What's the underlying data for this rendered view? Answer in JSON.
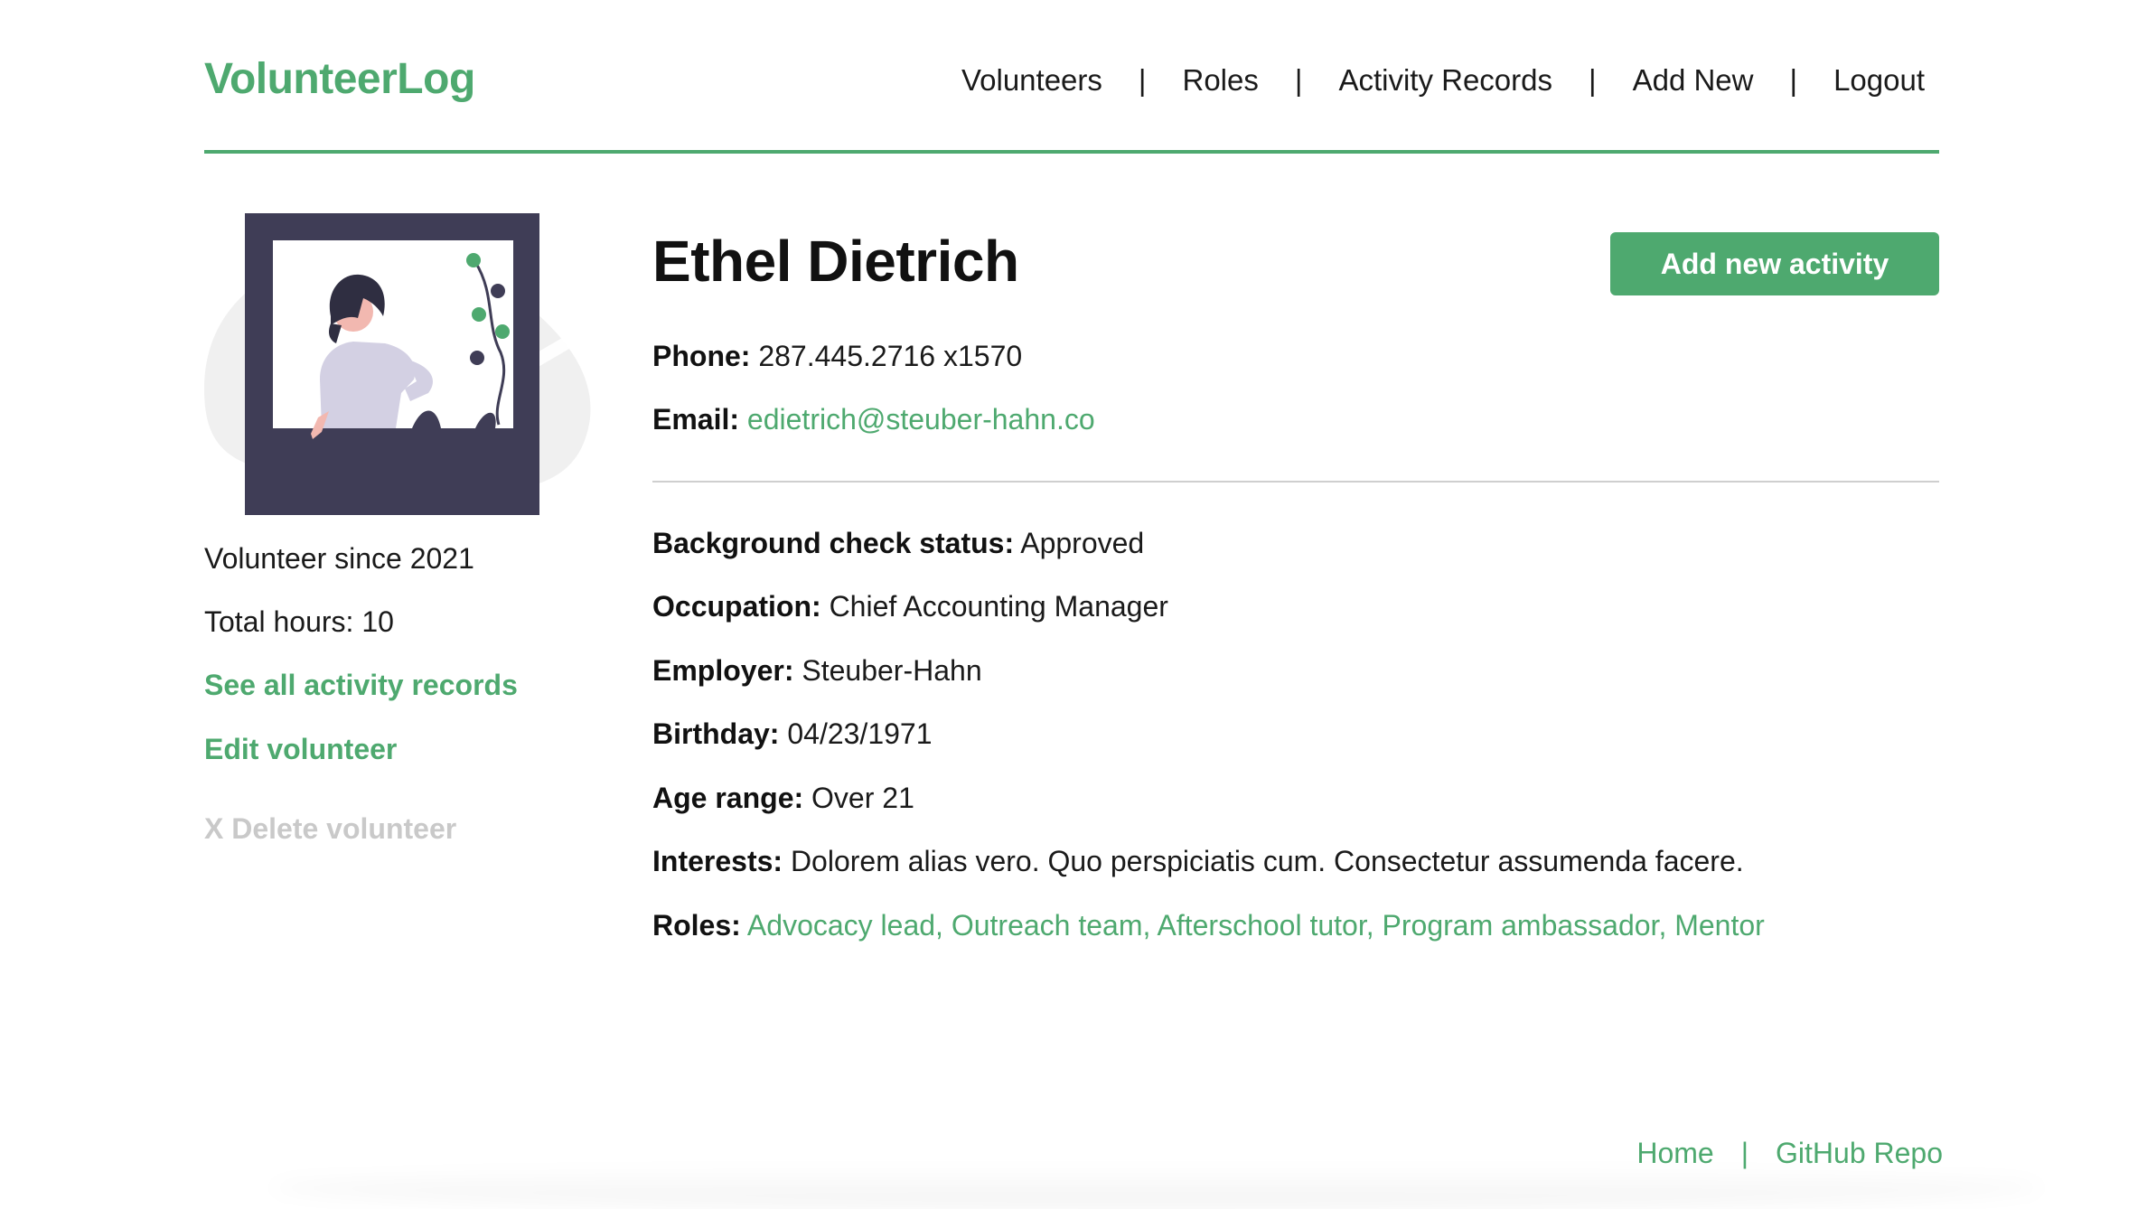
{
  "header": {
    "brand": "VolunteerLog",
    "nav": {
      "volunteers": "Volunteers",
      "roles": "Roles",
      "activity_records": "Activity Records",
      "add_new": "Add New",
      "logout": "Logout",
      "separator": "|"
    }
  },
  "sidebar": {
    "volunteer_since": "Volunteer since 2021",
    "total_hours": "Total hours: 10",
    "see_all_link": "See all activity records",
    "edit_link": "Edit volunteer",
    "delete_link": "X Delete volunteer"
  },
  "profile": {
    "name": "Ethel Dietrich",
    "add_activity_button": "Add new activity",
    "phone": {
      "label": "Phone:",
      "value": "287.445.2716 x1570"
    },
    "email": {
      "label": "Email:",
      "value": "edietrich@steuber-hahn.co"
    },
    "background_check": {
      "label": "Background check status:",
      "value": "Approved"
    },
    "occupation": {
      "label": "Occupation:",
      "value": "Chief Accounting Manager"
    },
    "employer": {
      "label": "Employer:",
      "value": "Steuber-Hahn"
    },
    "birthday": {
      "label": "Birthday:",
      "value": "04/23/1971"
    },
    "age_range": {
      "label": "Age range:",
      "value": "Over 21"
    },
    "interests": {
      "label": "Interests:",
      "value": "Dolorem alias vero. Quo perspiciatis cum. Consectetur assumenda facere."
    },
    "roles": {
      "label": "Roles:",
      "value": "Advocacy lead, Outreach team, Afterschool tutor, Program ambassador, Mentor"
    }
  },
  "footer": {
    "home": "Home",
    "github": "GitHub Repo",
    "separator": "|"
  },
  "colors": {
    "accent": "#4ea96f",
    "text": "#1a1a1a",
    "muted": "#c9c9c9",
    "frame": "#3f3d56"
  },
  "icons": {
    "avatar": "woman-in-window-illustration"
  }
}
